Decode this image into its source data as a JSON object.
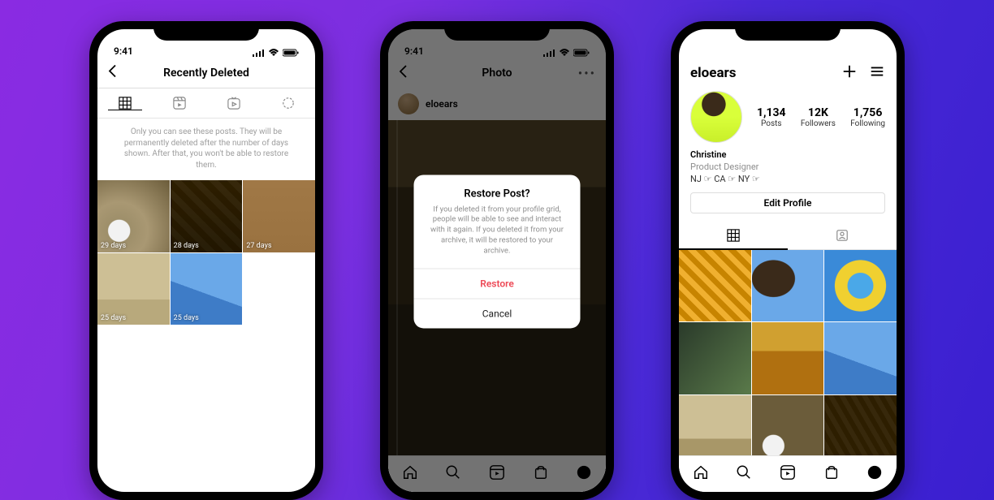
{
  "statusBar": {
    "time": "9:41"
  },
  "phone1": {
    "title": "Recently Deleted",
    "info": "Only you can see these posts. They will be permanently deleted after the number of days shown. After that, you won't be able to restore them.",
    "tabs": [
      "grid",
      "reels",
      "igtv",
      "story"
    ],
    "thumbs": [
      {
        "days": "29 days"
      },
      {
        "days": "28 days"
      },
      {
        "days": "27 days"
      },
      {
        "days": "25 days"
      },
      {
        "days": "25 days"
      }
    ]
  },
  "phone2": {
    "header": "Photo",
    "username": "eloears",
    "modal": {
      "title": "Restore Post?",
      "body": "If you deleted it from your profile grid, people will be able to see and interact with it again. If you deleted it from your archive, it will be restored to your archive.",
      "primary": "Restore",
      "secondary": "Cancel"
    }
  },
  "phone3": {
    "username": "eloears",
    "stats": {
      "posts_n": "1,134",
      "posts_l": "Posts",
      "followers_n": "12K",
      "followers_l": "Followers",
      "following_n": "1,756",
      "following_l": "Following"
    },
    "bio": {
      "name": "Christine",
      "title": "Product Designer",
      "line": "NJ ☞ CA ☞ NY ☞"
    },
    "editProfile": "Edit Profile"
  }
}
